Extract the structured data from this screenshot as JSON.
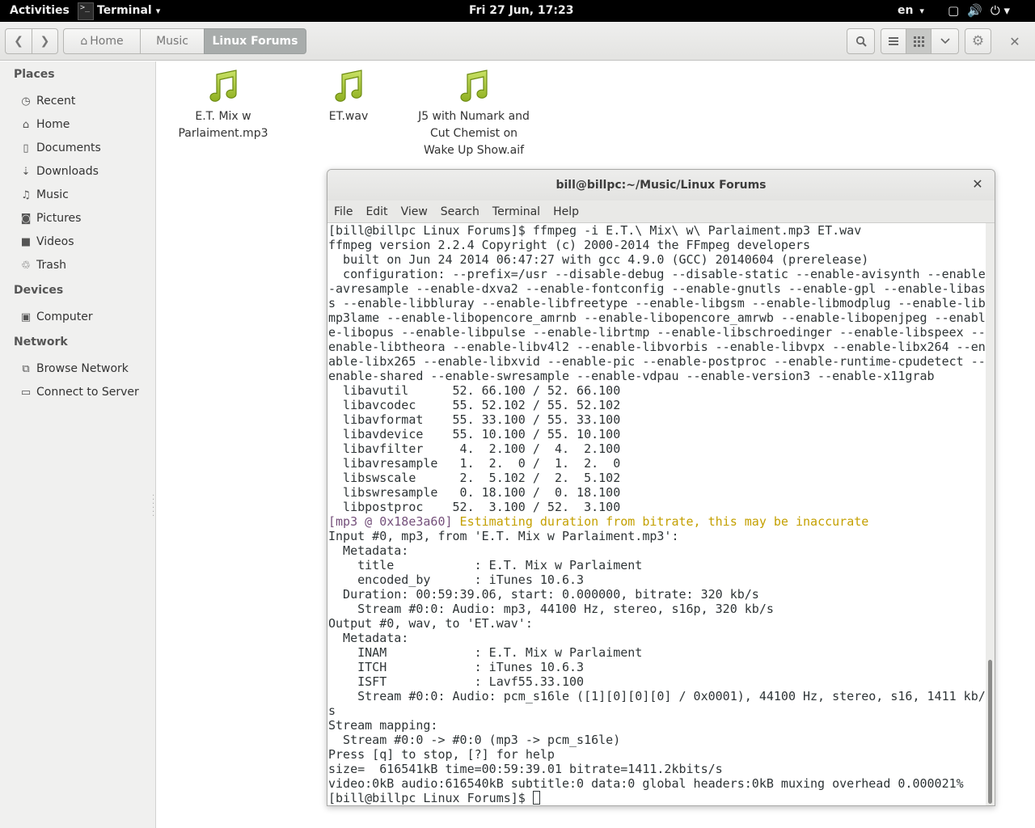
{
  "topbar": {
    "activities": "Activities",
    "app_name": "Terminal",
    "app_arrow": "▾",
    "clock": "Fri 27 Jun, 17:23",
    "language": "en",
    "language_arrow": "▾"
  },
  "files": {
    "breadcrumbs": [
      "Home",
      "Music",
      "Linux Forums"
    ],
    "icons": [
      "arrow-left-icon",
      "arrow-right-icon",
      "home-icon",
      "search-icon",
      "list-view-icon",
      "grid-view-icon",
      "chevron-down-icon",
      "gear-icon",
      "close-icon"
    ]
  },
  "sidebar": {
    "places_heading": "Places",
    "places": [
      {
        "label": "Recent",
        "icon": "clock-icon"
      },
      {
        "label": "Home",
        "icon": "home-icon"
      },
      {
        "label": "Documents",
        "icon": "document-icon"
      },
      {
        "label": "Downloads",
        "icon": "download-icon"
      },
      {
        "label": "Music",
        "icon": "music-icon"
      },
      {
        "label": "Pictures",
        "icon": "camera-icon"
      },
      {
        "label": "Videos",
        "icon": "video-icon"
      },
      {
        "label": "Trash",
        "icon": "trash-icon"
      }
    ],
    "devices_heading": "Devices",
    "devices": [
      {
        "label": "Computer",
        "icon": "drive-icon"
      }
    ],
    "network_heading": "Network",
    "network": [
      {
        "label": "Browse Network",
        "icon": "network-icon"
      },
      {
        "label": "Connect to Server",
        "icon": "server-icon"
      }
    ]
  },
  "file_items": [
    {
      "lines": [
        "E.T. Mix w",
        "Parlaiment.mp3"
      ]
    },
    {
      "lines": [
        "ET.wav"
      ]
    },
    {
      "lines": [
        "J5 with Numark and",
        "Cut Chemist on",
        "Wake Up Show.aif"
      ]
    }
  ],
  "terminal": {
    "title": "bill@billpc:~/Music/Linux Forums",
    "menu": [
      "File",
      "Edit",
      "View",
      "Search",
      "Terminal",
      "Help"
    ],
    "lines": [
      "[bill@billpc Linux Forums]$ ffmpeg -i E.T.\\ Mix\\ w\\ Parlaiment.mp3 ET.wav",
      "ffmpeg version 2.2.4 Copyright (c) 2000-2014 the FFmpeg developers",
      "  built on Jun 24 2014 06:47:27 with gcc 4.9.0 (GCC) 20140604 (prerelease)",
      "  configuration: --prefix=/usr --disable-debug --disable-static --enable-avisynth --enable",
      "-avresample --enable-dxva2 --enable-fontconfig --enable-gnutls --enable-gpl --enable-libas",
      "s --enable-libbluray --enable-libfreetype --enable-libgsm --enable-libmodplug --enable-lib",
      "mp3lame --enable-libopencore_amrnb --enable-libopencore_amrwb --enable-libopenjpeg --enabl",
      "e-libopus --enable-libpulse --enable-librtmp --enable-libschroedinger --enable-libspeex --",
      "enable-libtheora --enable-libv4l2 --enable-libvorbis --enable-libvpx --enable-libx264 --en",
      "able-libx265 --enable-libxvid --enable-pic --enable-postproc --enable-runtime-cpudetect --",
      "enable-shared --enable-swresample --enable-vdpau --enable-version3 --enable-x11grab",
      "  libavutil      52. 66.100 / 52. 66.100",
      "  libavcodec     55. 52.102 / 55. 52.102",
      "  libavformat    55. 33.100 / 55. 33.100",
      "  libavdevice    55. 10.100 / 55. 10.100",
      "  libavfilter     4.  2.100 /  4.  2.100",
      "  libavresample   1.  2.  0 /  1.  2.  0",
      "  libswscale      2.  5.102 /  2.  5.102",
      "  libswresample   0. 18.100 /  0. 18.100",
      "  libpostproc    52.  3.100 / 52.  3.100",
      "__WARN__",
      "Input #0, mp3, from 'E.T. Mix w Parlaiment.mp3':",
      "  Metadata:",
      "    title           : E.T. Mix w Parlaiment",
      "    encoded_by      : iTunes 10.6.3",
      "  Duration: 00:59:39.06, start: 0.000000, bitrate: 320 kb/s",
      "    Stream #0:0: Audio: mp3, 44100 Hz, stereo, s16p, 320 kb/s",
      "Output #0, wav, to 'ET.wav':",
      "  Metadata:",
      "    INAM            : E.T. Mix w Parlaiment",
      "    ITCH            : iTunes 10.6.3",
      "    ISFT            : Lavf55.33.100",
      "    Stream #0:0: Audio: pcm_s16le ([1][0][0][0] / 0x0001), 44100 Hz, stereo, s16, 1411 kb/",
      "s",
      "Stream mapping:",
      "  Stream #0:0 -> #0:0 (mp3 -> pcm_s16le)",
      "Press [q] to stop, [?] for help",
      "size=  616541kB time=00:59:39.01 bitrate=1411.2kbits/s",
      "video:0kB audio:616540kB subtitle:0 data:0 global headers:0kB muxing overhead 0.000021%",
      "__PROMPT__"
    ],
    "warn_tag": "[mp3 @ 0x18e3a60]",
    "warn_msg": " Estimating duration from bitrate, this may be inaccurate",
    "prompt": "[bill@billpc Linux Forums]$ ",
    "colors": {
      "warn_tag": "#75507b",
      "warn_msg": "#c4a000",
      "text": "#2e3436"
    }
  }
}
